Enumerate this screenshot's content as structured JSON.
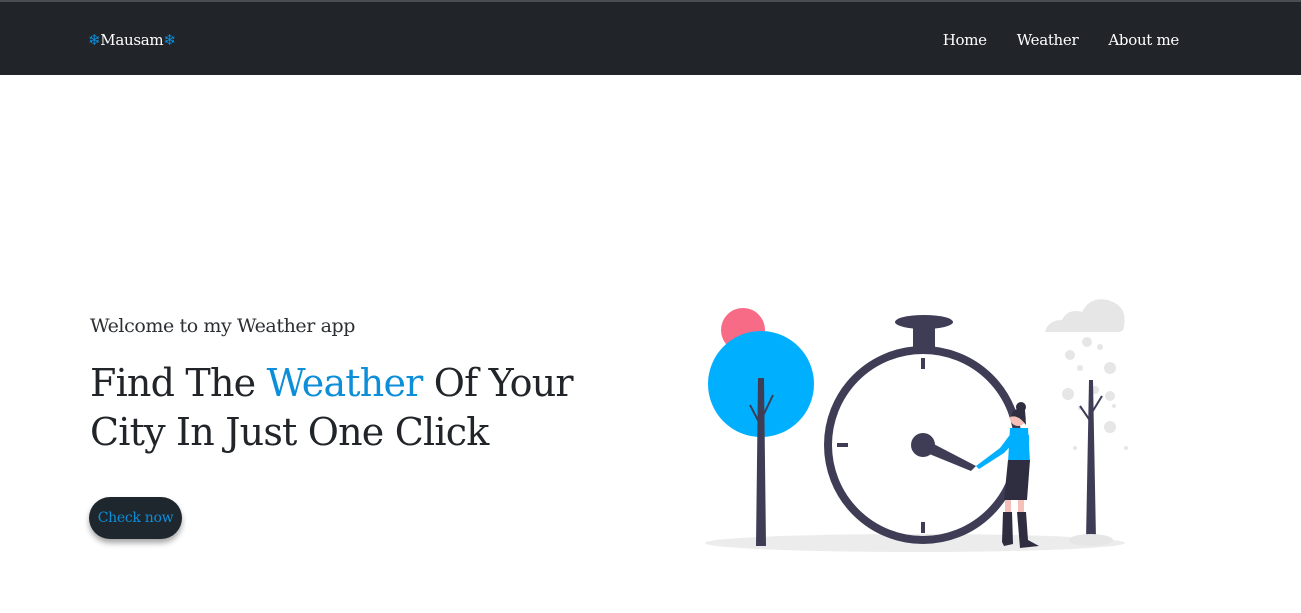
{
  "navbar": {
    "brand_icon_left": "❄",
    "brand_name": "Mausam",
    "brand_icon_right": "❄",
    "links": [
      "Home",
      "Weather",
      "About me"
    ]
  },
  "hero": {
    "welcome": "Welcome to my Weather app",
    "headline_part1": "Find The ",
    "headline_accent": "Weather",
    "headline_part2": " Of Your City In Just One Click",
    "cta_label": "Check now"
  },
  "colors": {
    "navbar_bg": "#212529",
    "accent": "#0d8ed9",
    "tree_blue": "#00b0ff",
    "sun_pink": "#f86b87",
    "clock_dark": "#3f3d56"
  },
  "illustration": {
    "description_icon": "clock-weather-illustration"
  }
}
